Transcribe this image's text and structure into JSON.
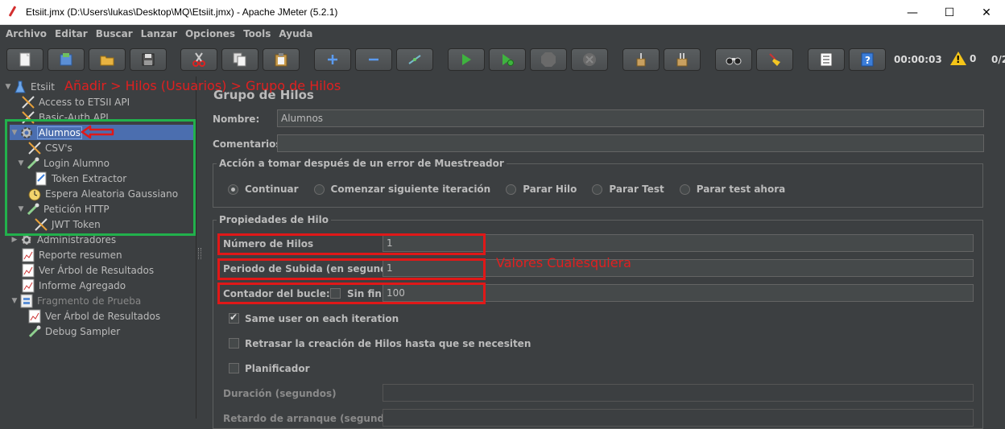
{
  "window": {
    "title": "Etsiit.jmx (D:\\Users\\lukas\\Desktop\\MQ\\Etsiit.jmx) - Apache JMeter (5.2.1)",
    "controls": {
      "minimize": "—",
      "maximize": "☐",
      "close": "✕"
    }
  },
  "menu": [
    "Archivo",
    "Editar",
    "Buscar",
    "Lanzar",
    "Opciones",
    "Tools",
    "Ayuda"
  ],
  "toolbar": {
    "buttons": [
      "new-icon",
      "templates-icon",
      "open-icon",
      "save-icon",
      "cut-icon",
      "copy-icon",
      "paste-icon",
      "expand-icon",
      "collapse-icon",
      "toggle-icon",
      "start-icon",
      "start-no-pauses-icon",
      "stop-icon",
      "shutdown-icon",
      "clear-icon",
      "clear-all-icon",
      "search-icon",
      "reset-search-icon",
      "function-helper-icon",
      "help-icon"
    ],
    "timer": "00:00:03",
    "warnings": "0",
    "threads": "0/2"
  },
  "tree": {
    "items": [
      {
        "label": "Etsiit",
        "icon": "flask-icon"
      },
      {
        "label": "Access to ETSII API",
        "icon": "wrench-icon"
      },
      {
        "label": "Basic-Auth API",
        "icon": "wrench-icon"
      },
      {
        "label": "Alumnos",
        "icon": "gear-icon"
      },
      {
        "label": "CSV's",
        "icon": "wrench-icon"
      },
      {
        "label": "Login Alumno",
        "icon": "pipette-icon"
      },
      {
        "label": "Token Extractor",
        "icon": "document-icon"
      },
      {
        "label": "Espera Aleatoria Gaussiano",
        "icon": "timer-icon"
      },
      {
        "label": "Petición HTTP",
        "icon": "pipette-icon"
      },
      {
        "label": "JWT Token",
        "icon": "wrench-icon"
      },
      {
        "label": "Administradores",
        "icon": "gear-icon"
      },
      {
        "label": "Reporte resumen",
        "icon": "chart-icon"
      },
      {
        "label": "Ver Árbol de Resultados",
        "icon": "chart-icon"
      },
      {
        "label": "Informe Agregado",
        "icon": "chart-icon"
      },
      {
        "label": "Fragmento de Prueba",
        "icon": "fragment-icon"
      },
      {
        "label": "Ver Árbol de Resultados",
        "icon": "chart-icon"
      },
      {
        "label": "Debug Sampler",
        "icon": "pipette-icon"
      }
    ]
  },
  "panel": {
    "title": "Grupo de Hilos",
    "name_label": "Nombre:",
    "name_value": "Alumnos",
    "comments_label": "Comentarios",
    "comments_value": "",
    "error_action": {
      "legend": "Acción a tomar después de un error de Muestreador",
      "options": [
        "Continuar",
        "Comenzar siguiente iteración",
        "Parar Hilo",
        "Parar Test",
        "Parar test ahora"
      ],
      "selected": "Continuar"
    },
    "thread_props": {
      "legend": "Propiedades de Hilo",
      "num_threads_label": "Número de Hilos",
      "num_threads_value": "1",
      "rampup_label": "Periodo de Subida (en segundos):",
      "rampup_value": "1",
      "loop_label": "Contador del bucle:",
      "forever_label": "Sin fin",
      "forever_checked": false,
      "loop_value": "100",
      "same_user_label": "Same user on each iteration",
      "same_user_checked": true,
      "delay_label": "Retrasar la creación de Hilos hasta que se necesiten",
      "delay_checked": false,
      "scheduler_label": "Planificador",
      "scheduler_checked": false,
      "duration_label": "Duración (segundos)",
      "duration_value": "",
      "startup_delay_label": "Retardo de arranque (segundos)",
      "startup_delay_value": ""
    }
  },
  "annotations": {
    "path_note": "Añadir > Hilos (Usuarios) > Grupo de Hilos",
    "values_note": "Valores Cualesquiera",
    "red": "#e01818",
    "green": "#22b14c"
  }
}
